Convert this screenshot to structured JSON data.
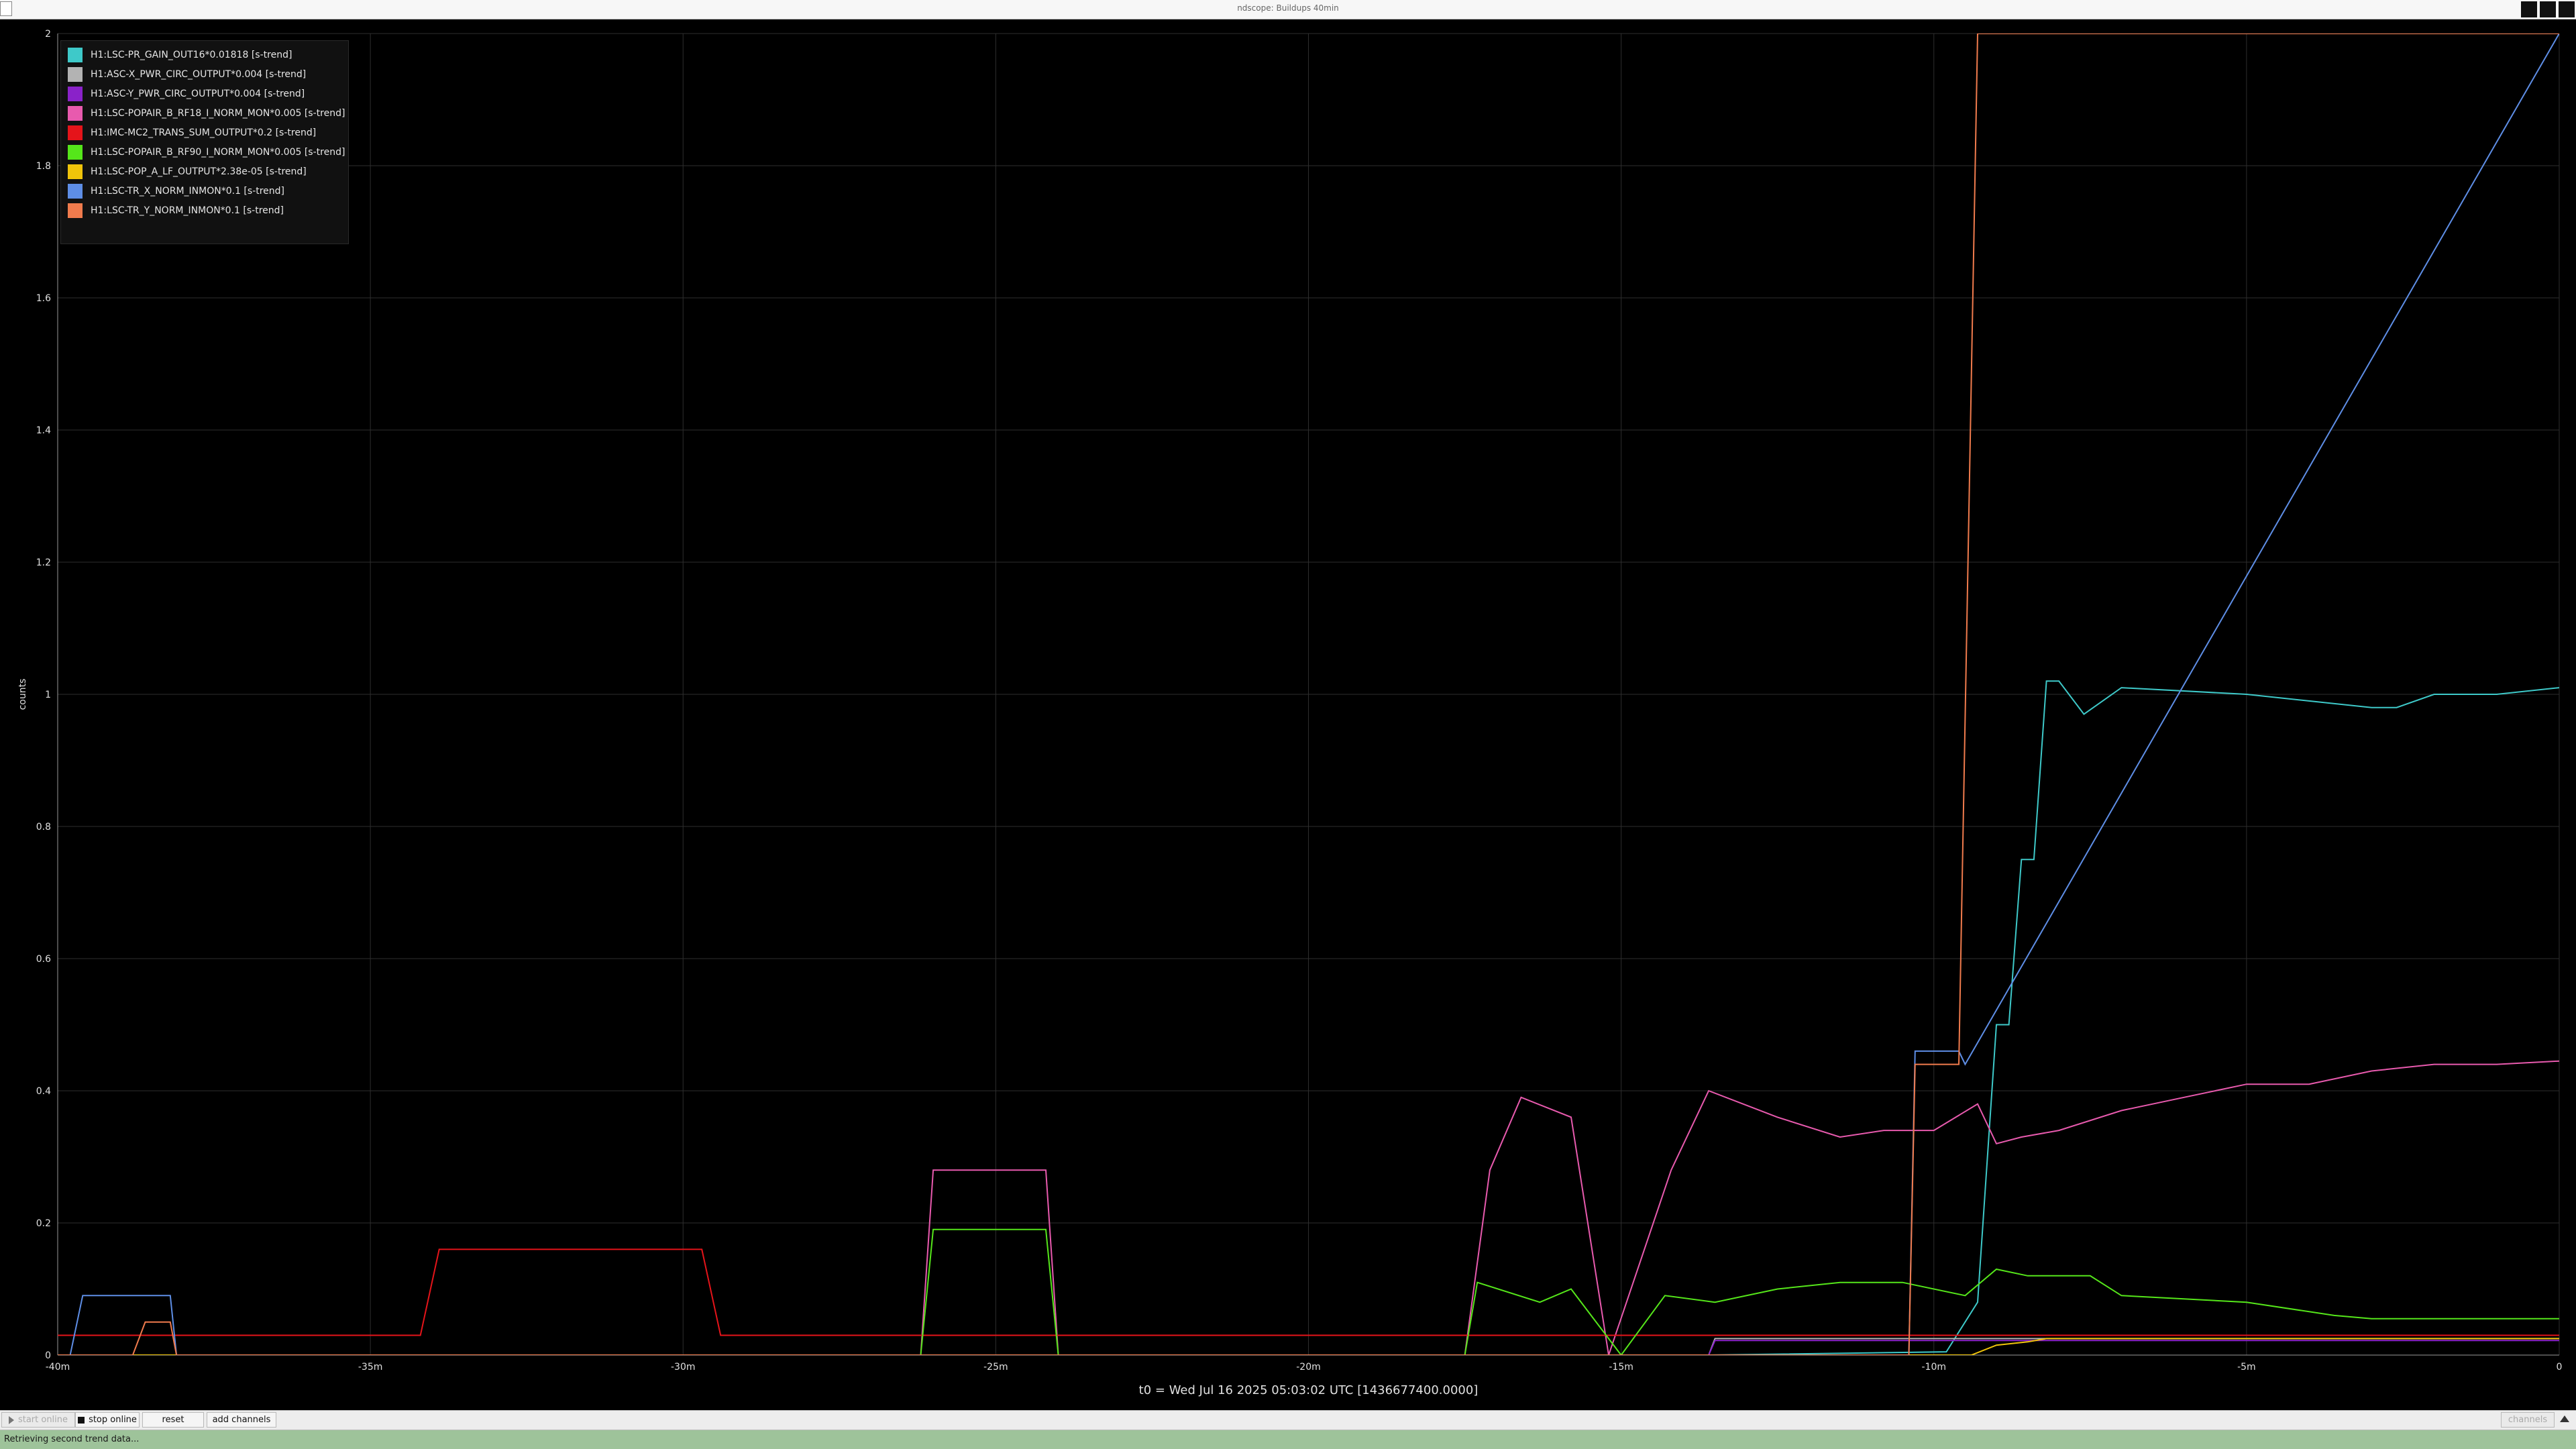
{
  "window": {
    "title": "ndscope: Buildups 40min"
  },
  "colors": {
    "background": "#000000",
    "grid": "#2e2e2e",
    "axis_text": "#e0e0e0",
    "status_bar": "#9ec39a"
  },
  "icons": [
    "window-icon",
    "minimize-icon",
    "maximize-icon",
    "close-icon",
    "stop-icon",
    "play-icon",
    "corner-arrow-icon"
  ],
  "chart_data": {
    "type": "line",
    "title": "",
    "xlabel": "t0 = Wed Jul 16 2025 05:03:02 UTC [1436677400.0000]",
    "ylabel": "counts",
    "xlim": [
      -40,
      0
    ],
    "ylim": [
      0,
      2
    ],
    "x_tick_labels": [
      {
        "x": -40,
        "label": "-40m"
      },
      {
        "x": -35,
        "label": "-35m"
      },
      {
        "x": -30,
        "label": "-30m"
      },
      {
        "x": -25,
        "label": "-25m"
      },
      {
        "x": -20,
        "label": "-20m"
      },
      {
        "x": -15,
        "label": "-15m"
      },
      {
        "x": -10,
        "label": "-10m"
      },
      {
        "x": -5,
        "label": "-5m"
      },
      {
        "x": 0,
        "label": "0"
      }
    ],
    "y_tick_labels": [
      {
        "y": 0,
        "label": "0"
      },
      {
        "y": 0.2,
        "label": "0.2"
      },
      {
        "y": 0.4,
        "label": "0.4"
      },
      {
        "y": 0.6,
        "label": "0.6"
      },
      {
        "y": 0.8,
        "label": "0.8"
      },
      {
        "y": 1,
        "label": "1"
      },
      {
        "y": 1.2,
        "label": "1.2"
      },
      {
        "y": 1.4,
        "label": "1.4"
      },
      {
        "y": 1.6,
        "label": "1.6"
      },
      {
        "y": 1.8,
        "label": "1.8"
      },
      {
        "y": 2,
        "label": "2"
      }
    ],
    "grid": true,
    "legend_position": "top-left",
    "series": [
      {
        "name": "H1:LSC-PR_GAIN_OUT16*0.01818 [s-trend]",
        "color": "#3ec9c9",
        "x": [
          -40,
          -13.6,
          -9.8,
          -9.3,
          -9.0,
          -8.8,
          -8.6,
          -8.4,
          -8.2,
          -8.0,
          -7.6,
          -7.0,
          -5.0,
          -3.0,
          -2.6,
          -2.0,
          -1.0,
          0
        ],
        "y": [
          0,
          0,
          0.005,
          0.08,
          0.5,
          0.5,
          0.75,
          0.75,
          1.02,
          1.02,
          0.97,
          1.01,
          1.0,
          0.98,
          0.98,
          1.0,
          1.0,
          1.01
        ]
      },
      {
        "name": "H1:ASC-X_PWR_CIRC_OUTPUT*0.004 [s-trend]",
        "color": "#b3b3b3",
        "x": [
          -40,
          -13.6,
          -13.5,
          -10.3,
          -9.6,
          -9.0,
          0
        ],
        "y": [
          0,
          0,
          0.025,
          0.025,
          0.025,
          0.025,
          0.025
        ]
      },
      {
        "name": "H1:ASC-Y_PWR_CIRC_OUTPUT*0.004 [s-trend]",
        "color": "#8a22c9",
        "x": [
          -40,
          -13.6,
          -13.5,
          -10.3,
          -9.6,
          0
        ],
        "y": [
          0,
          0,
          0.022,
          0.022,
          0.022,
          0.022
        ]
      },
      {
        "name": "H1:LSC-POPAIR_B_RF18_I_NORM_MON*0.005 [s-trend]",
        "color": "#e85aae",
        "x": [
          -40,
          -26.2,
          -26.0,
          -24.2,
          -24.0,
          -17.5,
          -17.1,
          -16.6,
          -15.8,
          -15.2,
          -14.2,
          -13.6,
          -12.5,
          -11.5,
          -10.8,
          -10.0,
          -9.3,
          -9.0,
          -8.6,
          -8.0,
          -7.0,
          -6.0,
          -5.0,
          -4.0,
          -3.0,
          -2.0,
          -1.0,
          0
        ],
        "y": [
          0,
          0,
          0.28,
          0.28,
          0,
          0,
          0.28,
          0.39,
          0.36,
          0,
          0.28,
          0.4,
          0.36,
          0.33,
          0.34,
          0.34,
          0.38,
          0.32,
          0.33,
          0.34,
          0.37,
          0.39,
          0.41,
          0.41,
          0.43,
          0.44,
          0.44,
          0.445
        ]
      },
      {
        "name": "H1:IMC-MC2_TRANS_SUM_OUTPUT*0.2 [s-trend]",
        "color": "#e5141a",
        "x": [
          -40,
          -34.2,
          -33.9,
          -29.7,
          -29.4,
          0
        ],
        "y": [
          0.03,
          0.03,
          0.16,
          0.16,
          0.03,
          0.03
        ]
      },
      {
        "name": "H1:LSC-POPAIR_B_RF90_I_NORM_MON*0.005 [s-trend]",
        "color": "#55e61a",
        "x": [
          -40,
          -26.2,
          -26.0,
          -24.2,
          -24.0,
          -17.5,
          -17.3,
          -16.3,
          -15.8,
          -15.0,
          -14.3,
          -13.5,
          -12.5,
          -11.5,
          -10.5,
          -9.5,
          -9.0,
          -8.5,
          -7.5,
          -7.0,
          -5.0,
          -3.6,
          -3.0,
          -1.0,
          0
        ],
        "y": [
          0,
          0,
          0.19,
          0.19,
          0,
          0,
          0.11,
          0.08,
          0.1,
          0,
          0.09,
          0.08,
          0.1,
          0.11,
          0.11,
          0.09,
          0.13,
          0.12,
          0.12,
          0.09,
          0.08,
          0.06,
          0.055,
          0.055,
          0.055
        ]
      },
      {
        "name": "H1:LSC-POP_A_LF_OUTPUT*2.38e-05 [s-trend]",
        "color": "#f0c40a",
        "x": [
          -40,
          -9.4,
          -9.0,
          -8.5,
          -8.2,
          -8.0,
          0
        ],
        "y": [
          0,
          0,
          0.015,
          0.02,
          0.025,
          0.025,
          0.025
        ]
      },
      {
        "name": "H1:LSC-TR_X_NORM_INMON*0.1 [s-trend]",
        "color": "#5e8ee6",
        "x": [
          -40,
          -39.8,
          -39.6,
          -38.2,
          -38.1,
          -10.4,
          -10.3,
          -9.6,
          -9.5,
          0
        ],
        "y": [
          0,
          0,
          0.09,
          0.09,
          0,
          0,
          0.46,
          0.46,
          0.44,
          2.0
        ]
      },
      {
        "name": "H1:LSC-TR_Y_NORM_INMON*0.1 [s-trend]",
        "color": "#f07b4d",
        "x": [
          -40,
          -38.8,
          -38.6,
          -38.2,
          -38.1,
          -10.4,
          -10.3,
          -9.6,
          -9.3,
          0
        ],
        "y": [
          0,
          0,
          0.05,
          0.05,
          0,
          0,
          0.44,
          0.44,
          2.0,
          2.0
        ]
      }
    ]
  },
  "toolbar": {
    "start_online_label": "start online",
    "stop_online_label": "stop online",
    "reset_label": "reset",
    "add_channels_label": "add channels",
    "right_button_label": "channels"
  },
  "status": {
    "text": "Retrieving second trend data..."
  }
}
